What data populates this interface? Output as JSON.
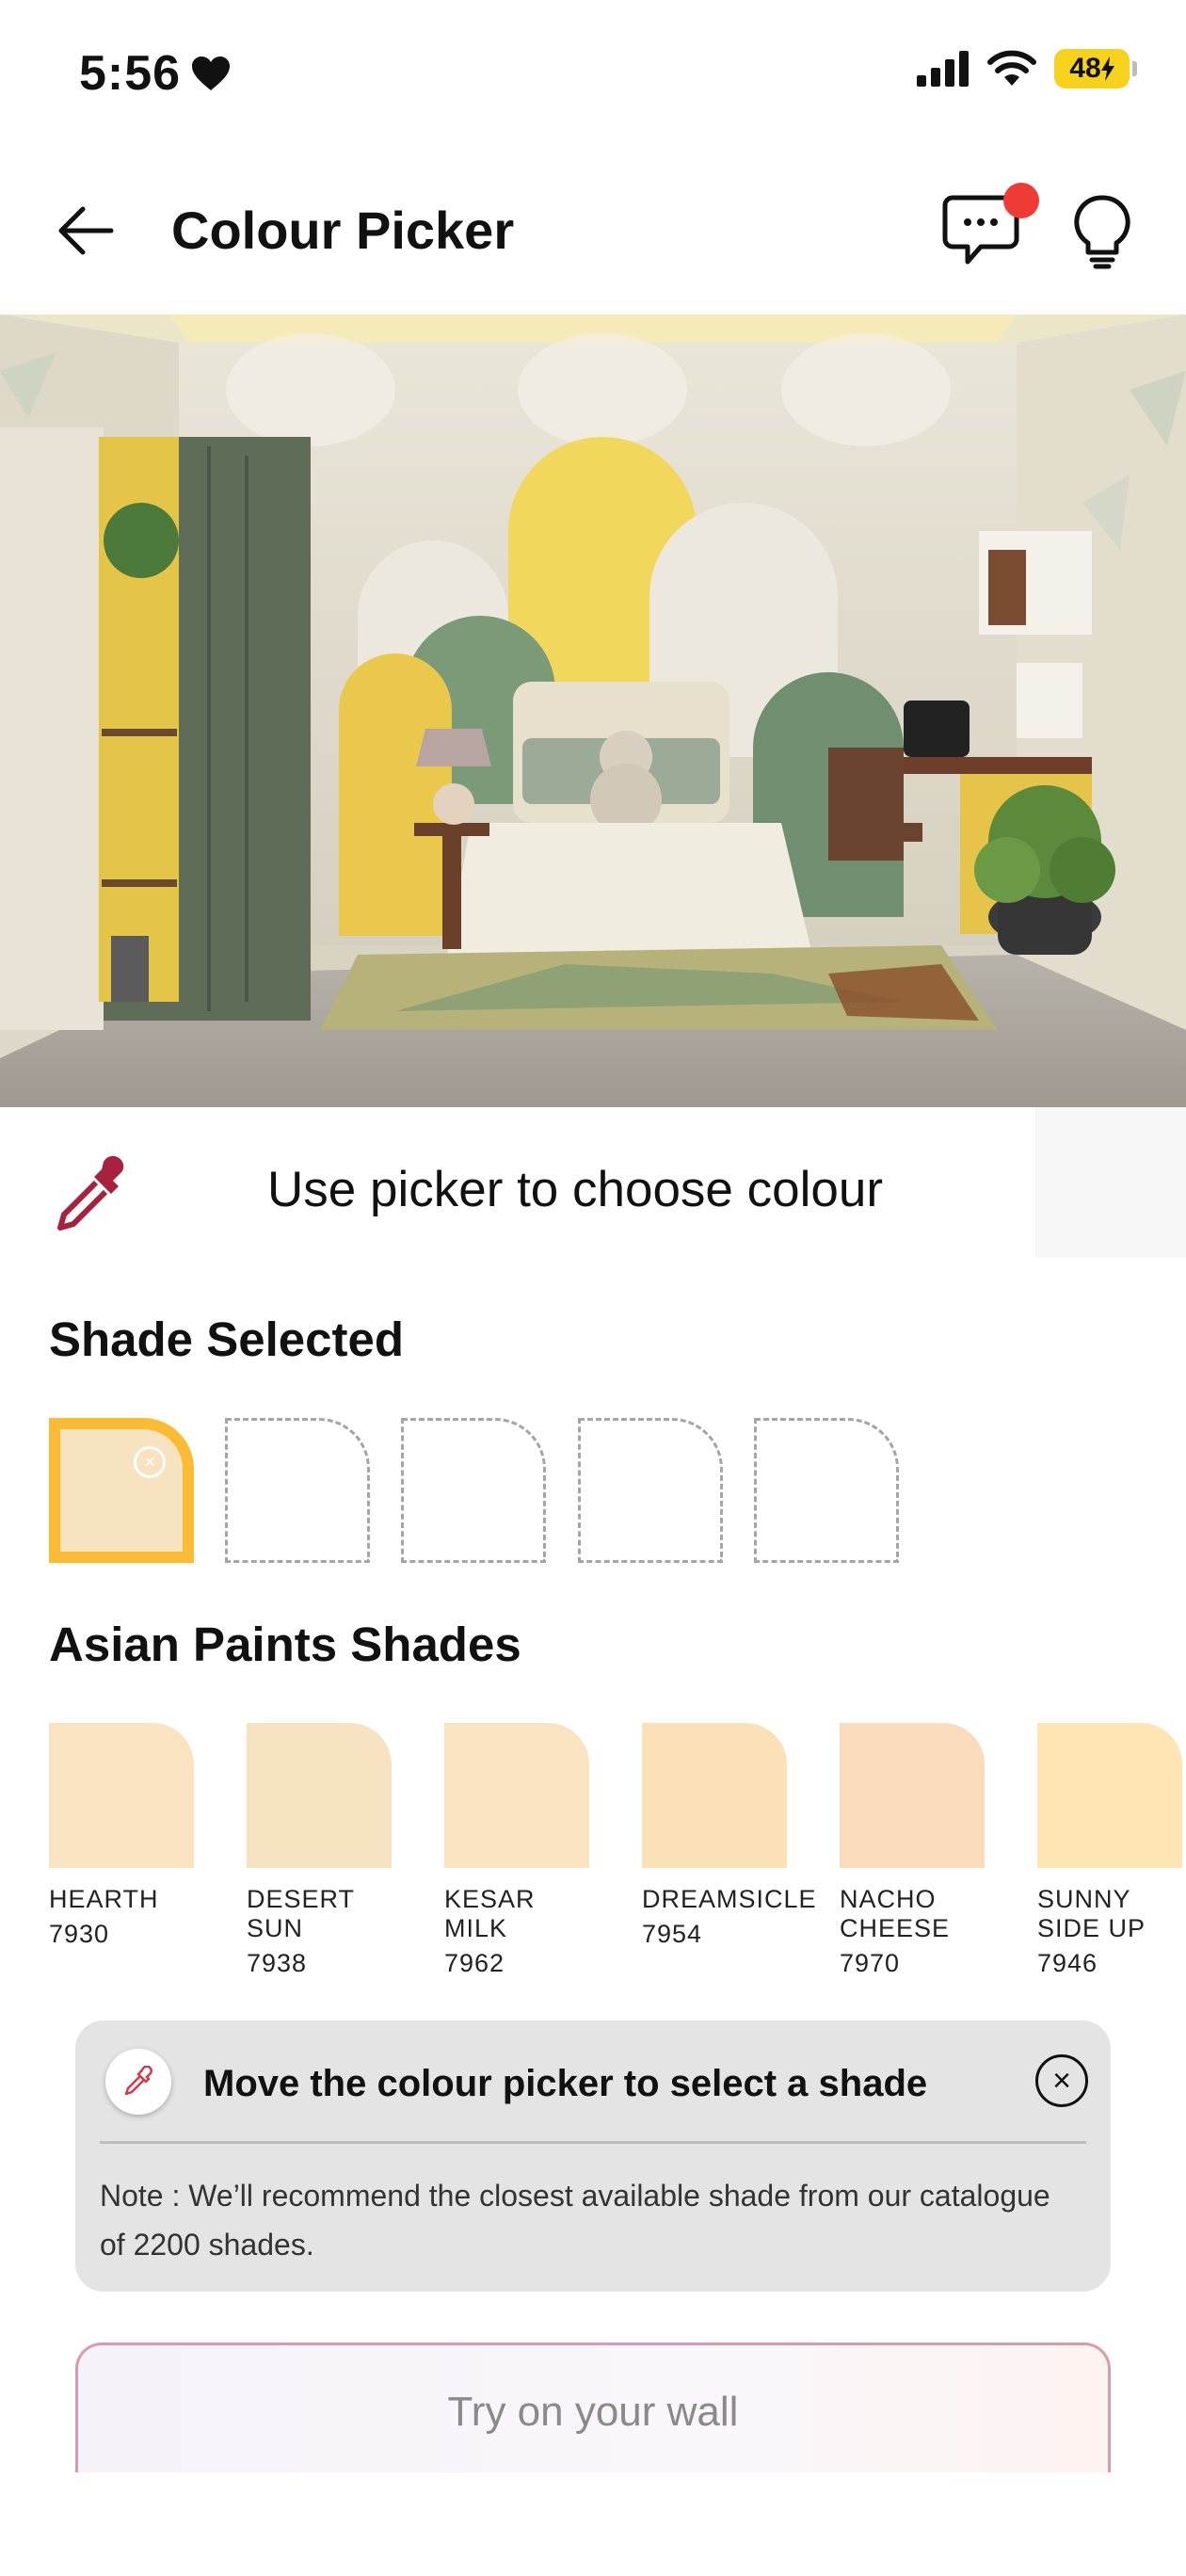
{
  "status_bar": {
    "time": "5:56",
    "battery": "48"
  },
  "header": {
    "title": "Colour Picker",
    "icons": [
      "back-arrow-icon",
      "chat-icon",
      "bulb-icon"
    ],
    "notification_color": "#ef3b35"
  },
  "picker": {
    "instruction": "Use picker to choose colour"
  },
  "shade_selected": {
    "title": "Shade Selected",
    "selected_color": "#f7e3c0",
    "highlight_color": "#fbbb34",
    "slots_total": 5
  },
  "asian_paints": {
    "title": "Asian Paints Shades",
    "shades": [
      {
        "name": "HEARTH",
        "code": "7930",
        "color": "#fae3c0"
      },
      {
        "name": "DESERT SUN",
        "code": "7938",
        "color": "#f7e2c2"
      },
      {
        "name": "KESAR MILK",
        "code": "7962",
        "color": "#f9e3c0"
      },
      {
        "name": "DREAMSICLE",
        "code": "7954",
        "color": "#fae1b8"
      },
      {
        "name": "NACHO CHEESE",
        "code": "7970",
        "color": "#fadcbc"
      },
      {
        "name": "SUNNY SIDE UP",
        "code": "7946",
        "color": "#fde5b4"
      }
    ]
  },
  "tip": {
    "title": "Move the  colour picker to select a shade",
    "note": "Note : We’ll recommend the closest available shade from our catalogue of 2200 shades."
  },
  "cta": {
    "label": "Try on your wall"
  }
}
